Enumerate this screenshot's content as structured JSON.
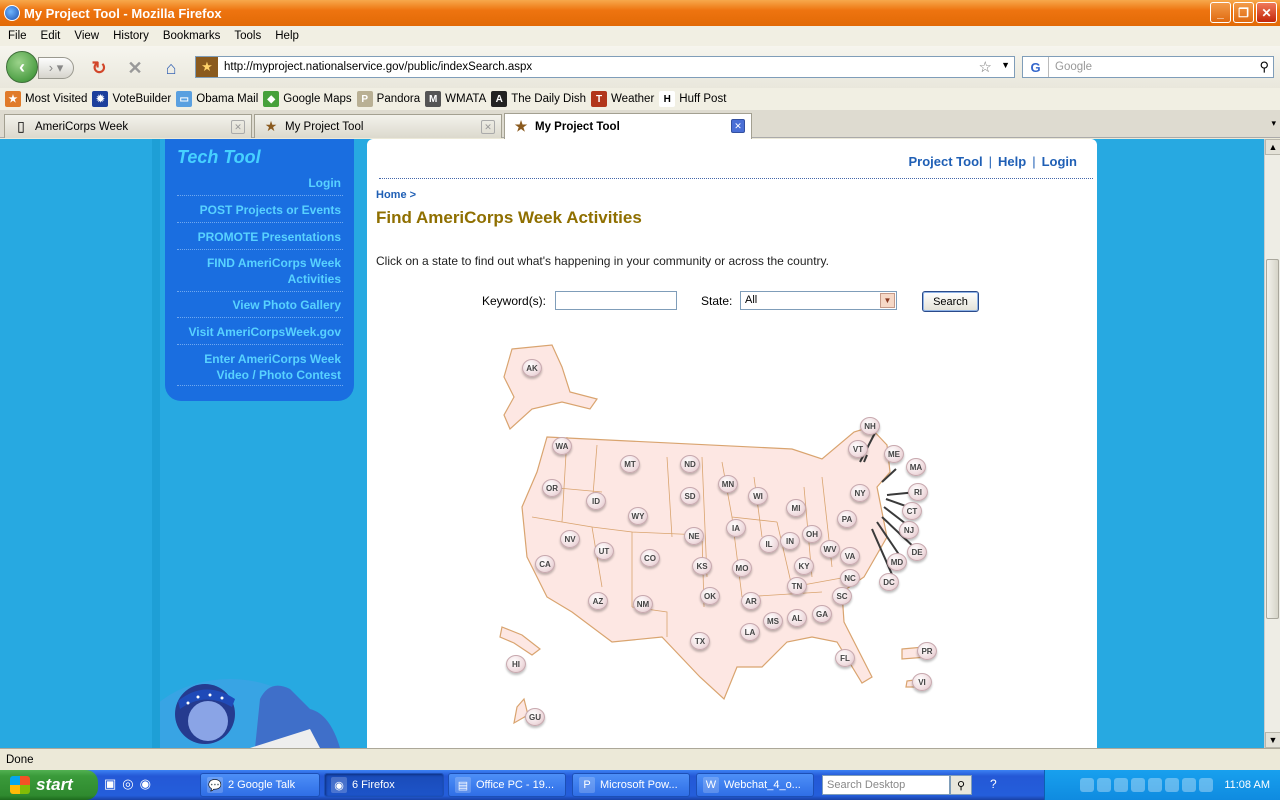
{
  "window": {
    "title": "My Project Tool - Mozilla Firefox",
    "controls": {
      "minimize": "_",
      "maximize": "❐",
      "close": "✕"
    }
  },
  "menu": [
    "File",
    "Edit",
    "View",
    "History",
    "Bookmarks",
    "Tools",
    "Help"
  ],
  "navbar": {
    "url": "http://myproject.nationalservice.gov/public/indexSearch.aspx",
    "search_placeholder": "Google",
    "search_engine_letter": "G",
    "icons": [
      "back-icon",
      "forward-icon",
      "reload-icon",
      "stop-icon",
      "home-icon"
    ]
  },
  "bookmarks": [
    {
      "label": "Most Visited",
      "color": "#e07b2a",
      "glyph": "★"
    },
    {
      "label": "VoteBuilder",
      "color": "#1c3f9c",
      "glyph": "✹"
    },
    {
      "label": "Obama Mail",
      "color": "#5aa0e0",
      "glyph": "▭"
    },
    {
      "label": "Google Maps",
      "color": "#46a03a",
      "glyph": "◆"
    },
    {
      "label": "Pandora",
      "color": "#b9b094",
      "glyph": "P"
    },
    {
      "label": "WMATA",
      "color": "#555555",
      "glyph": "M"
    },
    {
      "label": "The Daily Dish",
      "color": "#222222",
      "glyph": "A"
    },
    {
      "label": "Weather",
      "color": "#b2361b",
      "glyph": "TWC"
    },
    {
      "label": "Huff Post",
      "color": "#ffffff",
      "glyph": "H"
    }
  ],
  "tabs": [
    {
      "label": "AmeriCorps Week",
      "active": false
    },
    {
      "label": "My Project Tool",
      "active": false
    },
    {
      "label": "My Project Tool",
      "active": true
    }
  ],
  "sidebar": {
    "heading": "Tech Tool",
    "items": [
      "Login",
      "POST Projects or Events",
      "PROMOTE Presentations",
      "FIND AmeriCorps Week Activities",
      "View Photo Gallery",
      "Visit AmeriCorpsWeek.gov",
      "Enter AmeriCorps Week Video / Photo Contest"
    ]
  },
  "page": {
    "toplinks": [
      "Project Tool",
      "Help",
      "Login"
    ],
    "breadcrumb": "Home >",
    "heading": "Find AmeriCorps Week Activities",
    "intro": "Click on a state to find out what's happening in your community or across the country.",
    "keyword_label": "Keyword(s):",
    "keyword_value": "",
    "state_label": "State:",
    "state_value": "All",
    "search_button": "Search",
    "states": [
      "AK",
      "WA",
      "MT",
      "ND",
      "OR",
      "ID",
      "SD",
      "MN",
      "WI",
      "MI",
      "WY",
      "NE",
      "IA",
      "NV",
      "UT",
      "CO",
      "CA",
      "KS",
      "MO",
      "IL",
      "IN",
      "OH",
      "KY",
      "WV",
      "VA",
      "PA",
      "NY",
      "VT",
      "NH",
      "ME",
      "MA",
      "RI",
      "CT",
      "NJ",
      "DE",
      "MD",
      "DC",
      "NC",
      "SC",
      "TN",
      "AR",
      "OK",
      "NM",
      "AZ",
      "TX",
      "LA",
      "MS",
      "AL",
      "GA",
      "FL",
      "HI",
      "GU",
      "PR",
      "VI"
    ]
  },
  "status": "Done",
  "taskbar": {
    "start": "start",
    "items": [
      "2 Google Talk",
      "6 Firefox",
      "Office PC - 19...",
      "Microsoft Pow...",
      "Webchat_4_o..."
    ],
    "search_placeholder": "Search Desktop",
    "clock": "11:08 AM"
  },
  "colors": {
    "page_bg": "#27a9e1",
    "sidebar": "#1a6ee0",
    "heading": "#8f6f00",
    "link": "#1f5fb5",
    "map_fill": "#fde7e3"
  }
}
